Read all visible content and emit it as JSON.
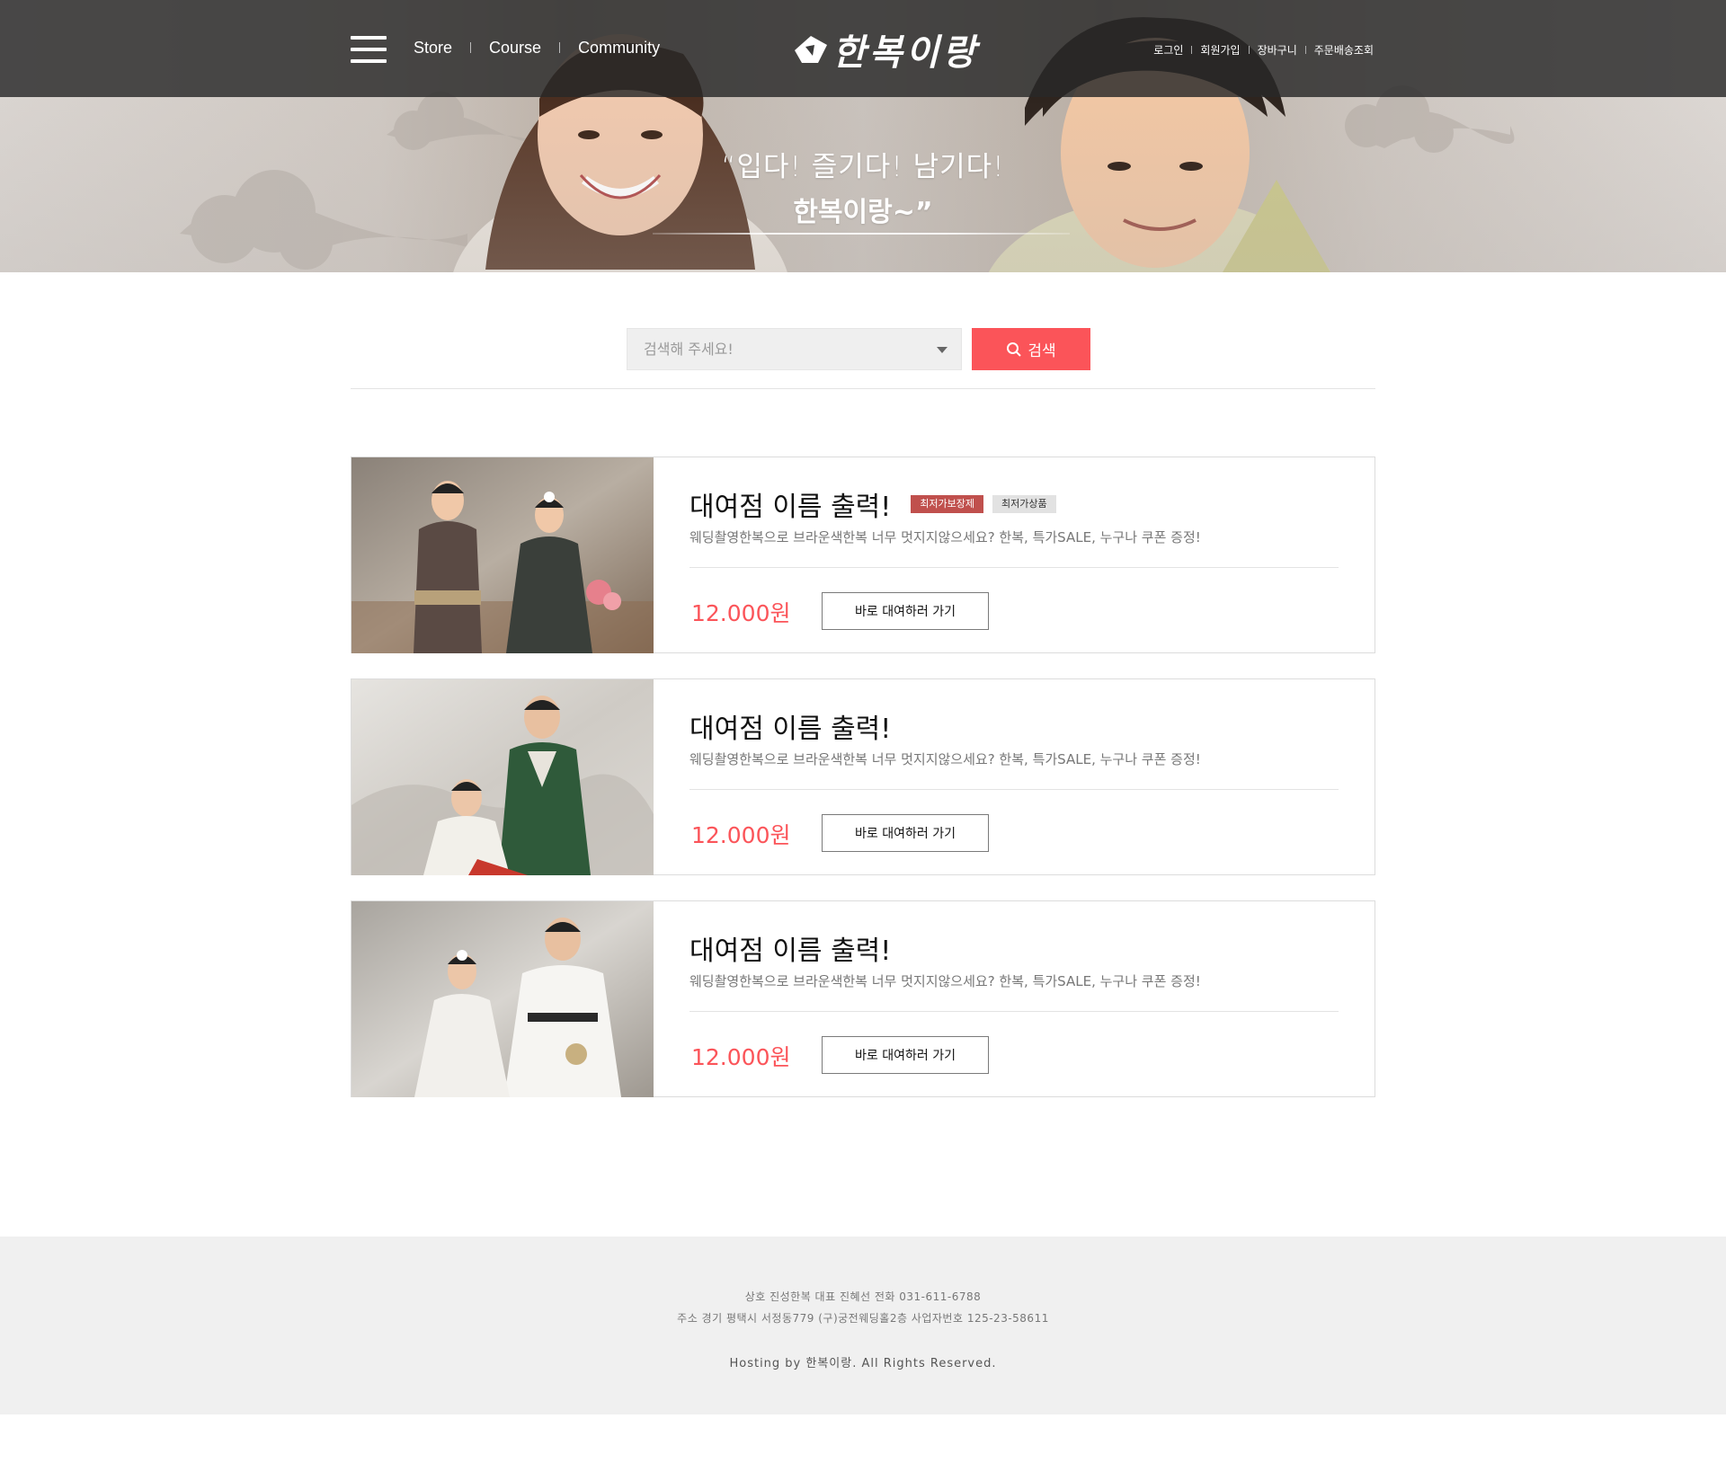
{
  "header": {
    "nav": [
      "Store",
      "Course",
      "Community"
    ],
    "logo_text": "한복이랑",
    "util_links": [
      "로그인",
      "회원가입",
      "장바구니",
      "주문배송조회"
    ]
  },
  "hero": {
    "slogan_line1": "“입다! 즐기다! 남기다!",
    "slogan_line2": "한복이랑~”"
  },
  "search": {
    "placeholder": "검색해 주세요!",
    "button_label": "검색",
    "icon": "search-icon"
  },
  "stores": [
    {
      "name": "대여점 이름 출력!",
      "badges": [
        "최저가보장제",
        "최저가상품"
      ],
      "description": "웨딩촬영한복으로 브라운색한복 너무 멋지지않으세요? 한복, 특가SALE, 누구나 쿠폰 증정!",
      "price": "12.000원",
      "button_label": "바로 대여하러 가기"
    },
    {
      "name": "대여점 이름 출력!",
      "badges": [],
      "description": "웨딩촬영한복으로 브라운색한복 너무 멋지지않으세요? 한복, 특가SALE, 누구나 쿠폰 증정!",
      "price": "12.000원",
      "button_label": "바로 대여하러 가기"
    },
    {
      "name": "대여점 이름 출력!",
      "badges": [],
      "description": "웨딩촬영한복으로 브라운색한복 너무 멋지지않으세요? 한복, 특가SALE, 누구나 쿠폰 증정!",
      "price": "12.000원",
      "button_label": "바로 대여하러 가기"
    }
  ],
  "footer": {
    "line1": "상호 진성한복 대표 진혜선 전화 031-611-6788",
    "line2": "주소 경기 평택시 서정동779 (구)궁전웨딩홀2층 사업자번호 125-23-58611",
    "line3": "Hosting by 한복이랑. All Rights Reserved."
  },
  "colors": {
    "accent": "#fb5459",
    "badge_red": "#c0504d",
    "badge_gray": "#e2e2e2",
    "topbar": "#3a3a3a",
    "footer_bg": "#f0f0f0"
  }
}
